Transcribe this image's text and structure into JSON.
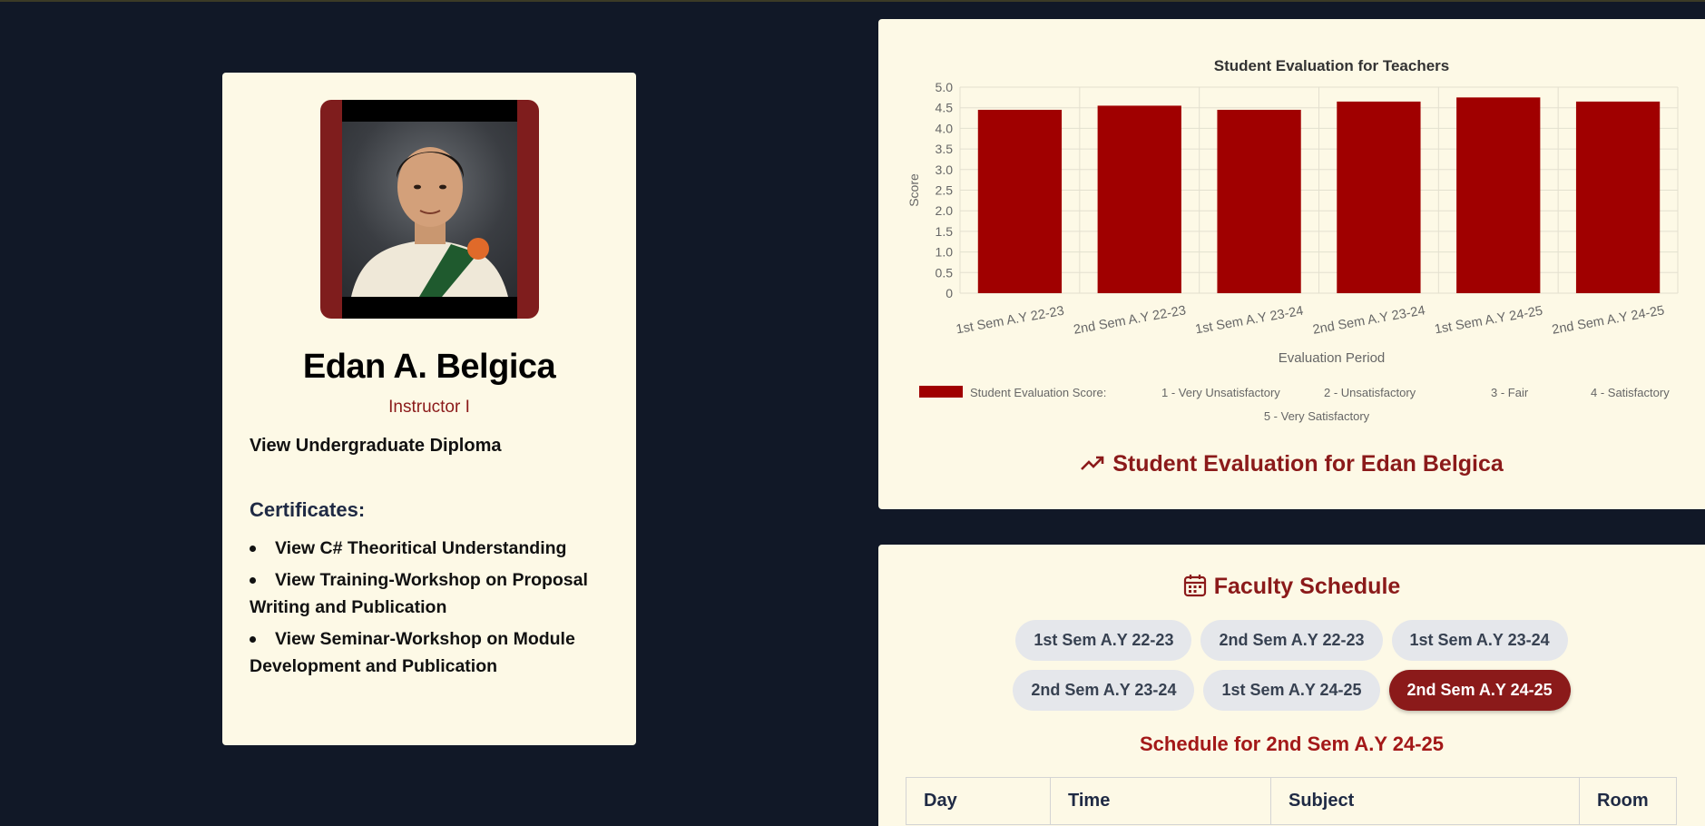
{
  "profile": {
    "name": "Edan A. Belgica",
    "role": "Instructor I",
    "diploma_link": "View Undergraduate Diploma",
    "certificates_title": "Certificates:",
    "certificates": [
      "View C# Theoritical Understanding",
      "View Training-Workshop on Proposal Writing and Publication",
      "View Seminar-Workshop on Module Development and Publication"
    ]
  },
  "evaluation": {
    "heading": "Student Evaluation for Edan Belgica"
  },
  "chart_data": {
    "type": "bar",
    "title": "Student Evaluation for Teachers",
    "xlabel": "Evaluation Period",
    "ylabel": "Score",
    "categories": [
      "1st Sem A.Y 22-23",
      "2nd Sem A.Y 22-23",
      "1st Sem A.Y 23-24",
      "2nd Sem A.Y 23-24",
      "1st Sem A.Y 24-25",
      "2nd Sem A.Y 24-25"
    ],
    "series": [
      {
        "name": "Student Evaluation Score:",
        "values": [
          4.45,
          4.55,
          4.45,
          4.65,
          4.75,
          4.65
        ],
        "color": "#a00000"
      }
    ],
    "ylim": [
      0,
      5.0
    ],
    "yticks": [
      "0",
      "0.5",
      "1.0",
      "1.5",
      "2.0",
      "2.5",
      "3.0",
      "3.5",
      "4.0",
      "4.5",
      "5.0"
    ],
    "legend_extra": [
      "1 - Very Unsatisfactory",
      "2 - Unsatisfactory",
      "3 - Fair",
      "4 - Satisfactory",
      "5 - Very Satisfactory"
    ],
    "grid": true,
    "legend_position": "bottom"
  },
  "schedule": {
    "heading": "Faculty Schedule",
    "tabs": [
      "1st Sem A.Y 22-23",
      "2nd Sem A.Y 22-23",
      "1st Sem A.Y 23-24",
      "2nd Sem A.Y 23-24",
      "1st Sem A.Y 24-25",
      "2nd Sem A.Y 24-25"
    ],
    "active_tab": "2nd Sem A.Y 24-25",
    "subheading": "Schedule for 2nd Sem A.Y 24-25",
    "columns": [
      "Day",
      "Time",
      "Subject",
      "Room"
    ]
  },
  "colors": {
    "background": "#111827",
    "card": "#fdf9e6",
    "accent": "#8b1a1a",
    "bar": "#a00000"
  }
}
